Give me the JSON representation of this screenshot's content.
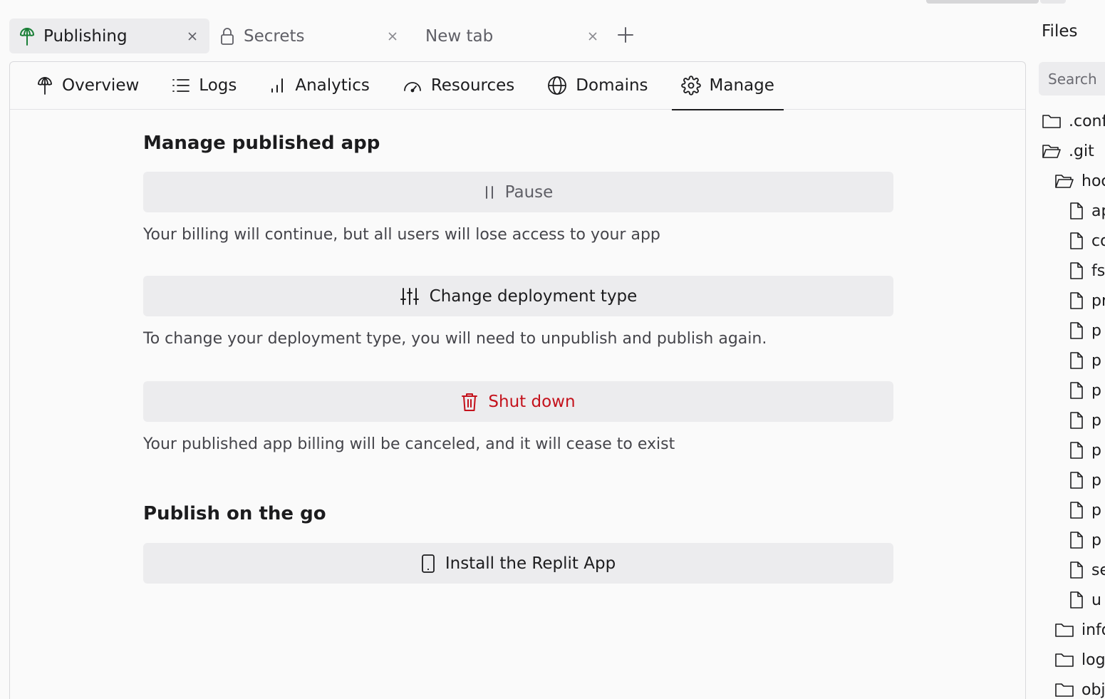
{
  "window": {
    "tabs": [
      {
        "label": "Publishing",
        "icon": "publishing-icon",
        "active": true
      },
      {
        "label": "Secrets",
        "icon": "lock-icon",
        "active": false
      },
      {
        "label": "New tab",
        "icon": "",
        "active": false
      }
    ]
  },
  "subnav": {
    "items": [
      {
        "label": "Overview",
        "icon": "publishing-icon"
      },
      {
        "label": "Logs",
        "icon": "list-icon"
      },
      {
        "label": "Analytics",
        "icon": "bar-chart-icon"
      },
      {
        "label": "Resources",
        "icon": "gauge-icon"
      },
      {
        "label": "Domains",
        "icon": "globe-icon"
      },
      {
        "label": "Manage",
        "icon": "gear-icon",
        "active": true
      }
    ]
  },
  "manage": {
    "title": "Manage published app",
    "pause_label": "Pause",
    "pause_desc": "Your billing will continue, but all users will lose access to your app",
    "change_label": "Change deployment type",
    "change_desc": "To change your deployment type, you will need to unpublish and publish again.",
    "shutdown_label": "Shut down",
    "shutdown_desc": "Your published app billing will be canceled, and it will cease to exist"
  },
  "go": {
    "title": "Publish on the go",
    "install_label": "Install the Replit App"
  },
  "files": {
    "title": "Files",
    "search_placeholder": "Search",
    "tree": [
      {
        "label": ".conf",
        "type": "folder"
      },
      {
        "label": ".git",
        "type": "folder-open"
      },
      {
        "label": "hoc",
        "type": "folder-open"
      },
      {
        "label": "ap",
        "type": "file"
      },
      {
        "label": "co",
        "type": "file"
      },
      {
        "label": "fs",
        "type": "file"
      },
      {
        "label": "pr",
        "type": "file"
      },
      {
        "label": "p",
        "type": "file"
      },
      {
        "label": "p",
        "type": "file"
      },
      {
        "label": "p",
        "type": "file"
      },
      {
        "label": "p",
        "type": "file"
      },
      {
        "label": "p",
        "type": "file"
      },
      {
        "label": "p",
        "type": "file"
      },
      {
        "label": "p",
        "type": "file"
      },
      {
        "label": "p",
        "type": "file"
      },
      {
        "label": "se",
        "type": "file"
      },
      {
        "label": "u",
        "type": "file"
      },
      {
        "label": "info",
        "type": "folder"
      },
      {
        "label": "log",
        "type": "folder"
      },
      {
        "label": "obj",
        "type": "folder"
      }
    ]
  },
  "colors": {
    "danger": "#c4121c",
    "brand_green": "#1a7f37",
    "surface": "#ececee"
  }
}
